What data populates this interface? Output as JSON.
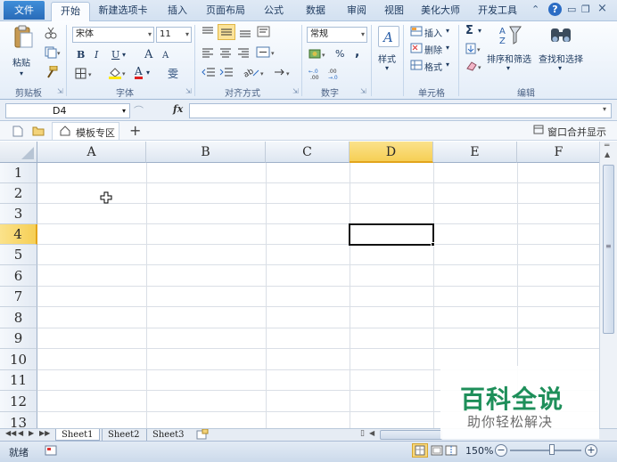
{
  "tabs": {
    "file": "文件",
    "items": [
      "开始",
      "新建选项卡",
      "插入",
      "页面布局",
      "公式",
      "数据",
      "审阅",
      "视图",
      "美化大师",
      "开发工具"
    ],
    "active_index": 0
  },
  "window": {
    "help": "?"
  },
  "ribbon": {
    "clipboard": {
      "paste": "粘贴",
      "label": "剪贴板"
    },
    "font": {
      "name": "宋体",
      "size": "11",
      "bold": "B",
      "italic": "I",
      "underline": "U",
      "grow": "A",
      "shrink": "A",
      "font_color": "A",
      "phonetic": "雯",
      "label": "字体"
    },
    "alignment": {
      "label": "对齐方式"
    },
    "number": {
      "format": "常规",
      "percent": "%",
      "comma": ",",
      "inc": "+.0 .00",
      "dec": ".00 +.0",
      "label": "数字"
    },
    "styles": {
      "label": "样式"
    },
    "cells": {
      "insert": "插入",
      "delete": "删除",
      "format": "格式",
      "label": "单元格"
    },
    "editing": {
      "sum": "Σ",
      "sort_filter": "排序和筛选",
      "find_select": "查找和选择",
      "label": "编辑"
    }
  },
  "formula_bar": {
    "name_box": "D4",
    "fx": "fx",
    "value": ""
  },
  "doc_tabs": {
    "template_zone": "模板专区",
    "add": "+",
    "window_merge": "窗口合并显示"
  },
  "sheet": {
    "columns": [
      "A",
      "B",
      "C",
      "D",
      "E",
      "F"
    ],
    "rows": [
      "1",
      "2",
      "3",
      "4",
      "5",
      "6",
      "7",
      "8",
      "9",
      "10",
      "11",
      "12",
      "13"
    ],
    "active_col": "D",
    "active_row": "4"
  },
  "sheet_tabs": {
    "items": [
      "Sheet1",
      "Sheet2",
      "Sheet3"
    ],
    "active": "Sheet1"
  },
  "status": {
    "ready": "就绪",
    "zoom": "150%",
    "minus": "−",
    "plus": "+"
  },
  "watermark": {
    "title": "百科全说",
    "subtitle": "助你轻松解决"
  },
  "colors": {
    "accent": "#2a6bb8",
    "selection_header": "#f6cf55",
    "watermark_green": "#1e8f5a"
  }
}
